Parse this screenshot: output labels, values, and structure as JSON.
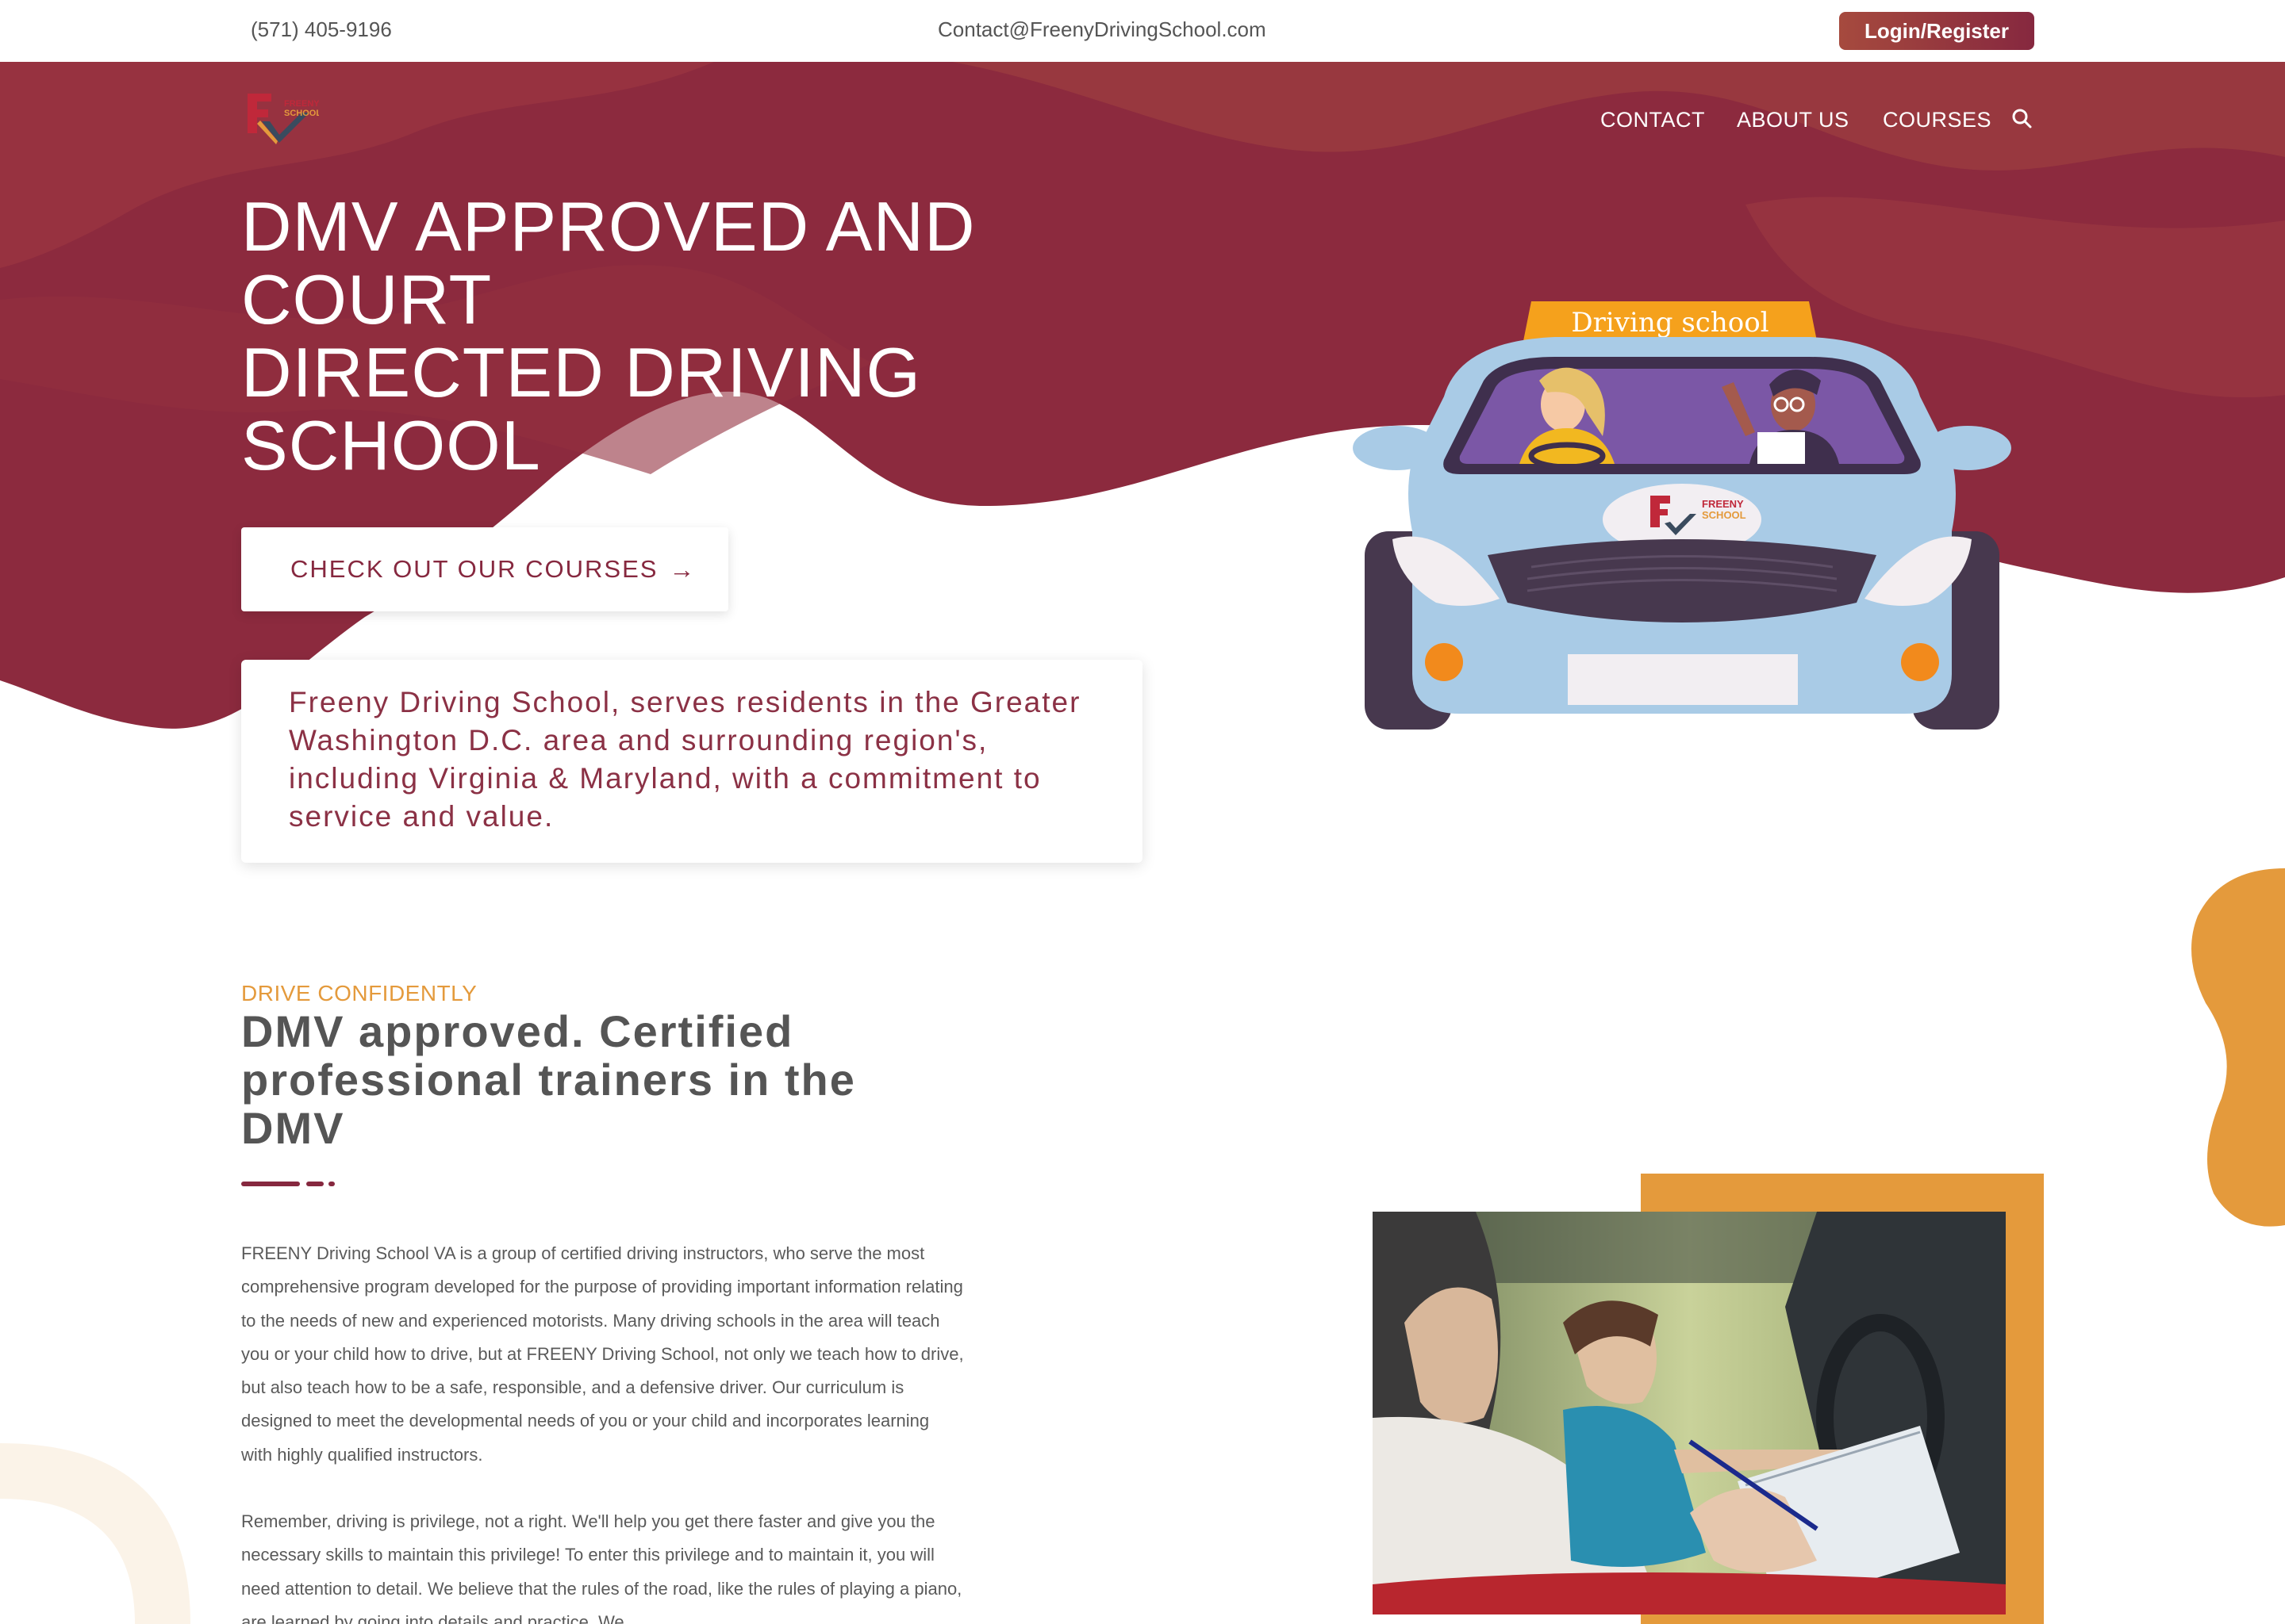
{
  "topbar": {
    "phone": "(571) 405-9196",
    "email": "Contact@FreenyDrivingSchool.com",
    "login_label": "Login/Register"
  },
  "nav": {
    "logo_text": [
      "FREENY",
      "SCHOOL"
    ],
    "items": [
      {
        "label": "CONTACT"
      },
      {
        "label": "ABOUT US"
      },
      {
        "label": "COURSES"
      }
    ],
    "search_icon": "search-icon"
  },
  "hero": {
    "title_lines": [
      "DMV APPROVED AND",
      "COURT",
      "DIRECTED DRIVING",
      "SCHOOL"
    ],
    "cta_label": "CHECK OUT OUR COURSES",
    "cta_icon": "arrow-right-icon",
    "intro": "Freeny Driving School, serves residents in the Greater Washington D.C. area and surrounding region's, including Virginia & Maryland, with a commitment to service and value.",
    "car_sign": "Driving school",
    "car_badge": [
      "FREENY",
      "SCHOOL"
    ]
  },
  "section": {
    "eyebrow": "DRIVE CONFIDENTLY",
    "title": "DMV approved. Certified professional trainers in the DMV",
    "paragraph1": "FREENY Driving School VA is a group of certified driving instructors, who serve the most comprehensive program developed for the purpose of providing important information relating to the needs of new and experienced motorists. Many driving schools in the area will teach you or your child how to drive, but at FREENY Driving School, not only we teach how to drive, but also teach how to be a safe, responsible, and a defensive driver. Our curriculum is designed to meet the developmental needs of you or your child and incorporates learning with highly qualified instructors.",
    "paragraph2": "Remember, driving is privilege, not a right. We'll help you get there faster and give you the necessary skills to maintain this privilege! To enter this privilege and to maintain it, you will need attention to detail. We believe that the rules of the road, like the rules of playing a piano, are learned by going into details and practice. We"
  },
  "colors": {
    "brand": "#86283f",
    "accent": "#e49a3c",
    "wave_dark": "#8c2a3e",
    "wave_light": "#a0403f"
  }
}
